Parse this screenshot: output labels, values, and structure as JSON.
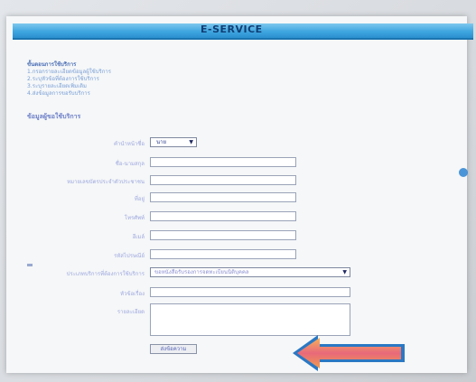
{
  "window": {
    "title": "E-SERVICE"
  },
  "steps": {
    "heading": "ขั้นตอนการใช้บริการ",
    "items": [
      "1.กรอกรายละเอียดข้อมูลผู้ใช้บริการ",
      "2.ระบุหัวข้อที่ต้องการใช้บริการ",
      "3.ระบุรายละเอียดเพิ่มเติม",
      "4.ส่งข้อมูลการขอรับบริการ"
    ]
  },
  "form": {
    "section_title": "ข้อมูลผู้ขอใช้บริการ",
    "fields": {
      "prefix": {
        "label": "คำนำหน้าชื่อ",
        "value": "นาย"
      },
      "fullname": {
        "label": "ชื่อ-นามสกุล",
        "value": ""
      },
      "id_card": {
        "label": "หมายเลขบัตรประจำตัวประชาชน",
        "value": ""
      },
      "address": {
        "label": "ที่อยู่",
        "value": ""
      },
      "phone": {
        "label": "โทรศัพท์",
        "value": ""
      },
      "email": {
        "label": "อีเมล์",
        "value": ""
      },
      "postcode": {
        "label": "รหัสไปรษณีย์",
        "value": ""
      },
      "service_type": {
        "label": "ประเภทบริการที่ต้องการใช้บริการ",
        "value": "ขอหนังสือรับรองการจดทะเบียนนิติบุคคล"
      },
      "subject": {
        "label": "หัวข้อเรื่อง",
        "value": ""
      },
      "details": {
        "label": "รายละเอียด",
        "value": ""
      }
    },
    "submit_label": "ส่งข้อความ"
  },
  "colors": {
    "banner": "#3fa6e0",
    "label_text": "#9fa8df",
    "arrow_fill": "#e8697a",
    "arrow_edge": "#f2a14a",
    "arrow_border": "#2a78c4"
  }
}
